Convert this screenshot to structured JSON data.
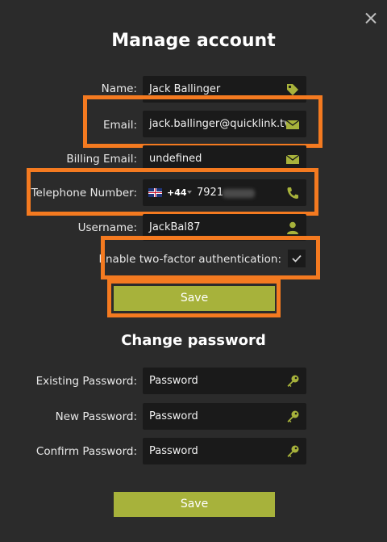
{
  "header": {
    "title": "Manage account"
  },
  "account": {
    "name": {
      "label": "Name:",
      "value": "Jack Ballinger",
      "icon": "tag-icon"
    },
    "email": {
      "label": "Email:",
      "value": "jack.ballinger@quicklink.tv",
      "icon": "envelope-icon"
    },
    "billing_email": {
      "label": "Billing Email:",
      "value": "undefined",
      "icon": "envelope-icon"
    },
    "telephone": {
      "label": "Telephone Number:",
      "country_code": "+44",
      "value": "7921",
      "flag": "uk-flag-icon",
      "icon": "phone-icon"
    },
    "username": {
      "label": "Username:",
      "value": "JackBal87",
      "icon": "user-icon"
    },
    "two_factor": {
      "label": "Enable two-factor authentication:",
      "checked": true
    },
    "save_label": "Save"
  },
  "password": {
    "title": "Change password",
    "existing": {
      "label": "Existing Password:",
      "placeholder": "Password",
      "icon": "key-icon"
    },
    "new": {
      "label": "New Password:",
      "placeholder": "Password",
      "icon": "key-icon"
    },
    "confirm": {
      "label": "Confirm Password:",
      "placeholder": "Password",
      "icon": "key-icon"
    },
    "save_label": "Save"
  },
  "colors": {
    "background": "#2b2b2b",
    "field": "#1a1a1a",
    "accent": "#a7b23b",
    "icon": "#a7b23b",
    "highlight": "#f47a20"
  }
}
